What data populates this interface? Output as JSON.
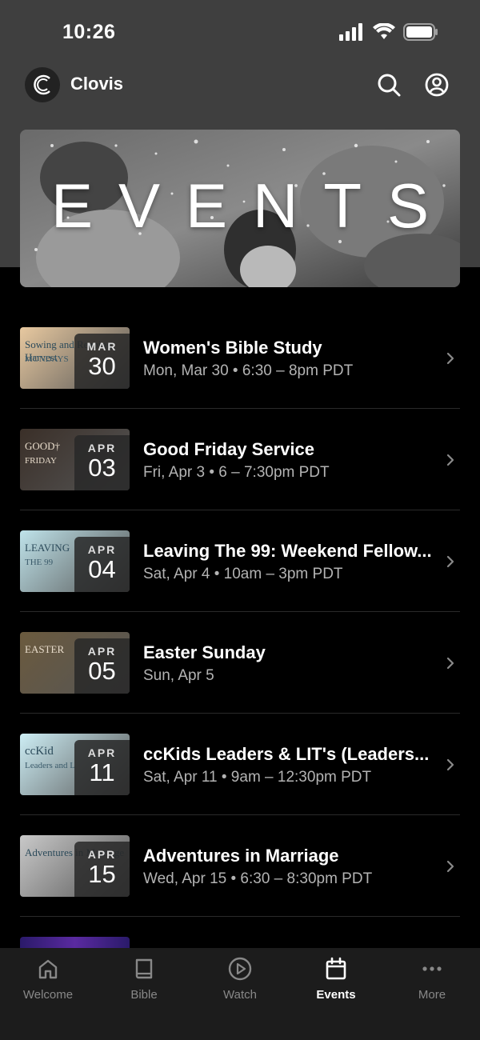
{
  "status_bar": {
    "time": "10:26"
  },
  "header": {
    "title": "Clovis",
    "logo_letter": "C"
  },
  "banner": {
    "title": "EVENTS"
  },
  "events": [
    {
      "title": "Women's Bible Study",
      "time": "Mon, Mar 30 • 6:30 – 8pm PDT",
      "month": "MAR",
      "day": "30",
      "thumb_text": "Sowing and Reaping Harvest",
      "thumb_sub": "MONDAYS",
      "thumb_color": "#e8c9a0"
    },
    {
      "title": "Good Friday Service",
      "time": "Fri, Apr 3 • 6 – 7:30pm PDT",
      "month": "APR",
      "day": "03",
      "thumb_text": "GOOD†",
      "thumb_sub": "FRIDAY",
      "thumb_color": "#3a2f28"
    },
    {
      "title": "Leaving The 99: Weekend Fellow...",
      "time": "Sat, Apr 4 • 10am – 3pm PDT",
      "month": "APR",
      "day": "04",
      "thumb_text": "LEAVING",
      "thumb_sub": "THE 99",
      "thumb_color": "#bfe3ea"
    },
    {
      "title": "Easter Sunday",
      "time": "Sun, Apr 5",
      "month": "APR",
      "day": "05",
      "thumb_text": "EASTER",
      "thumb_sub": "",
      "thumb_color": "#6b5a3e"
    },
    {
      "title": "ccKids Leaders & LIT's (Leaders...",
      "time": "Sat, Apr 11 • 9am – 12:30pm PDT",
      "month": "APR",
      "day": "11",
      "thumb_text": "ccKid",
      "thumb_sub": "Leaders and LIT's Conference",
      "thumb_color": "#cdeef5"
    },
    {
      "title": "Adventures in Marriage",
      "time": "Wed, Apr 15 • 6:30 – 8:30pm PDT",
      "month": "APR",
      "day": "15",
      "thumb_text": "Adventures in Marriage",
      "thumb_sub": "",
      "thumb_color": "#c9c9c9"
    }
  ],
  "tabs": [
    {
      "label": "Welcome",
      "icon": "home-icon",
      "active": false
    },
    {
      "label": "Bible",
      "icon": "book-icon",
      "active": false
    },
    {
      "label": "Watch",
      "icon": "play-icon",
      "active": false
    },
    {
      "label": "Events",
      "icon": "calendar-icon",
      "active": true
    },
    {
      "label": "More",
      "icon": "more-icon",
      "active": false
    }
  ]
}
